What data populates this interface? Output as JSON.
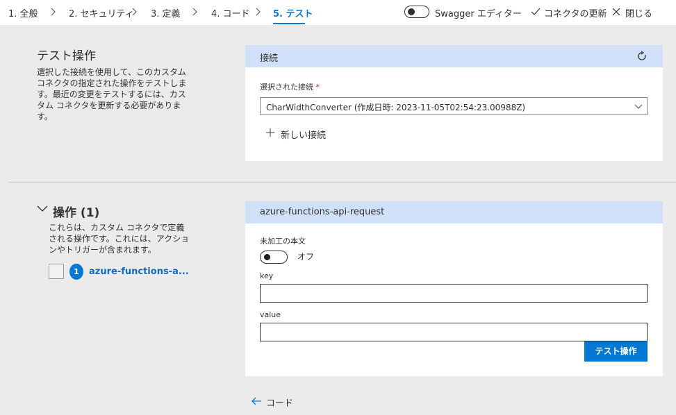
{
  "nav": {
    "steps": [
      {
        "label": "1. 全般"
      },
      {
        "label": "2. セキュリティ"
      },
      {
        "label": "3. 定義"
      },
      {
        "label": "4. コード"
      },
      {
        "label": "5. テスト"
      }
    ],
    "swagger_label": "Swagger エディター",
    "update_label": "コネクタの更新",
    "close_label": "閉じる"
  },
  "test_section": {
    "title": "テスト操作",
    "description": "選択した接続を使用して、このカスタム コネクタの指定された操作をテストします。最近の変更をテストするには、カスタム コネクタを更新する必要があります。",
    "card_title": "接続",
    "selected_label": "選択された接続",
    "required_mark": "*",
    "selected_value": "CharWidthConverter (作成日時: 2023-11-05T02:54:23.00988Z)",
    "new_connection": "新しい接続"
  },
  "ops_section": {
    "title": "操作 (1)",
    "description": "これらは、カスタム コネクタで定義される操作です。これには、アクションやトリガーが含まれます。",
    "op_number": "1",
    "op_name": "azure-functions-a..."
  },
  "request_card": {
    "title": "azure-functions-api-request",
    "raw_body_label": "未加工の本文",
    "toggle_state": "オフ",
    "key_label": "key",
    "key_value": "",
    "value_label": "value",
    "value_value": "",
    "test_button": "テスト操作"
  },
  "footer": {
    "back_label": "コード"
  }
}
